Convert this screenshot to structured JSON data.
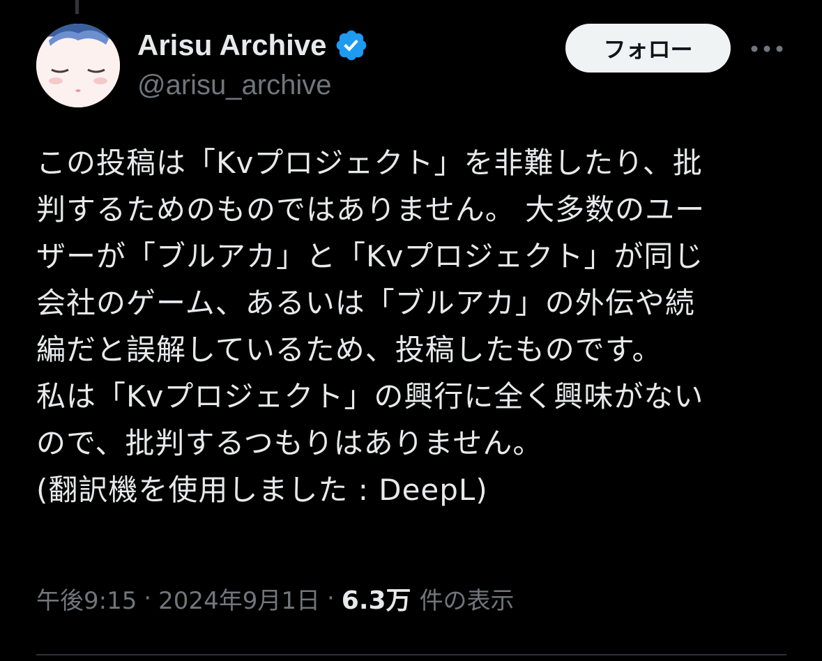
{
  "author": {
    "display_name": "Arisu Archive",
    "handle": "@arisu_archive",
    "verified": true,
    "verified_color": "#1d9bf0"
  },
  "actions": {
    "follow_label": "フォロー",
    "more_icon": "more-horizontal-icon"
  },
  "tweet": {
    "lines": [
      "この投稿は「Kvプロジェクト」を非難したり、批",
      "判するためのものではありません。 大多数のユー",
      "ザーが「ブルアカ」と「Kvプロジェクト」が同じ",
      "会社のゲーム、あるいは「ブルアカ」の外伝や続",
      "編だと誤解しているため、投稿したものです。",
      "私は「Kvプロジェクト」の興行に全く興味がない",
      "ので、批判するつもりはありません。",
      "(翻訳機を使用しました : DeepL)"
    ]
  },
  "meta": {
    "time": "午後9:15",
    "separator": "·",
    "date": "2024年9月1日",
    "views_count": "6.3万",
    "views_label": "件の表示"
  }
}
